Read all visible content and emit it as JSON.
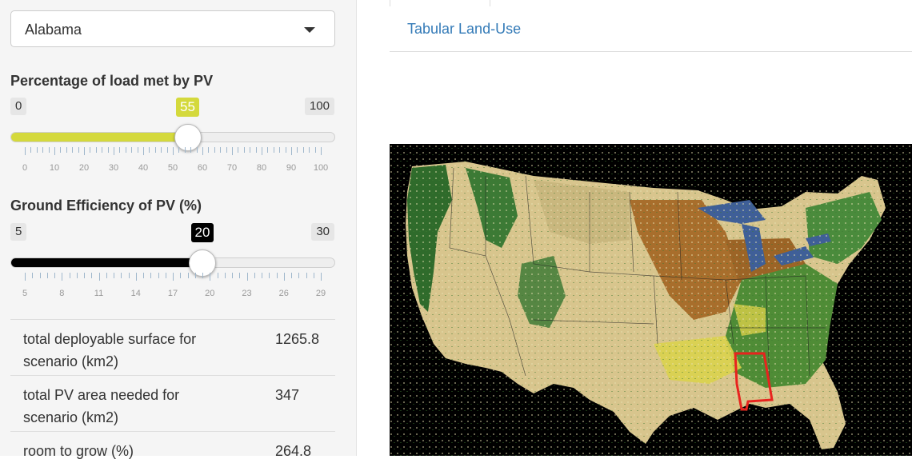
{
  "state_select": {
    "value": "Alabama"
  },
  "slider_load": {
    "label": "Percentage of load met by PV",
    "min_label": "0",
    "max_label": "100",
    "value_label": "55",
    "value": 55,
    "min": 0,
    "max": 100,
    "fill_color": "#d4d93c",
    "tick_labels": [
      "0",
      "10",
      "20",
      "30",
      "40",
      "50",
      "60",
      "70",
      "80",
      "90",
      "100"
    ]
  },
  "slider_eff": {
    "label": "Ground Efficiency of PV (%)",
    "min_label": "5",
    "max_label": "30",
    "value_label": "20",
    "value": 20,
    "min": 5,
    "max": 30,
    "fill_color": "#000000",
    "tick_labels": [
      "5",
      "8",
      "11",
      "14",
      "17",
      "20",
      "23",
      "26",
      "29"
    ]
  },
  "stats": [
    {
      "key": "total deployable surface for scenario (km2)",
      "value": "1265.8"
    },
    {
      "key": "total PV area needed for scenario (km2)",
      "value": "347"
    },
    {
      "key": "room to grow (%)",
      "value": "264.8"
    }
  ],
  "tabs": {
    "active_link": "Tabular Land-Use"
  },
  "colors": {
    "link": "#337ab7",
    "load_fill": "#d4d93c",
    "eff_fill": "#000000",
    "highlight_state": "#e8231e"
  }
}
